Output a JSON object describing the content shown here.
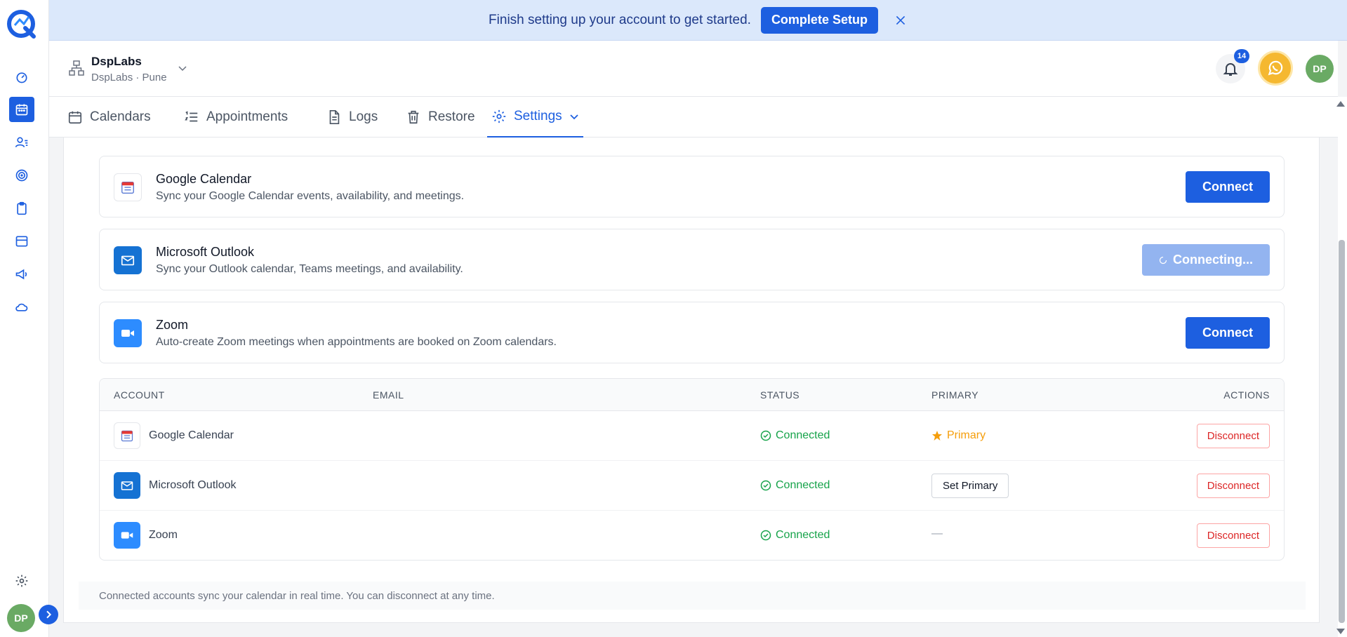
{
  "banner": {
    "message": "Finish setting up your account to get started.",
    "cta_label": "Complete Setup"
  },
  "header": {
    "org_name": "DspLabs",
    "org_sub": "DspLabs · Pune",
    "notification_count": "14",
    "avatar_initials": "DP"
  },
  "sidebar": {
    "avatar_initials": "DP",
    "items": [
      "dashboard-icon",
      "calendar-icon",
      "contacts-icon",
      "target-icon",
      "clipboard-icon",
      "inbox-icon",
      "megaphone-icon",
      "cloud-icon",
      "gear-icon"
    ]
  },
  "tabs": [
    {
      "label": "Calendars",
      "icon": "calendar-icon"
    },
    {
      "label": "Appointments",
      "icon": "list-icon"
    },
    {
      "label": "Logs",
      "icon": "document-icon"
    },
    {
      "label": "Restore",
      "icon": "trash-icon"
    },
    {
      "label": "Settings",
      "icon": "gear-icon",
      "active": true
    }
  ],
  "integrations": [
    {
      "title": "Google Calendar",
      "desc": "Sync your Google Calendar events, availability, and meetings.",
      "button": "Connect"
    },
    {
      "title": "Microsoft Outlook",
      "desc": "Sync your Outlook calendar, Teams meetings, and availability.",
      "button": "Connecting..."
    },
    {
      "title": "Zoom",
      "desc": "Auto-create Zoom meetings when appointments are booked on Zoom calendars.",
      "button": "Connect"
    }
  ],
  "table": {
    "headers": {
      "account": "ACCOUNT",
      "email": "EMAIL",
      "status": "STATUS",
      "primary": "PRIMARY",
      "actions": "ACTIONS"
    },
    "rows": [
      {
        "account": "Google Calendar",
        "status": "Connected",
        "primary": "Primary",
        "action": "Disconnect"
      },
      {
        "account": "Microsoft Outlook",
        "status": "Connected",
        "primary": "Set Primary",
        "action": "Disconnect"
      },
      {
        "account": "Zoom",
        "status": "Connected",
        "primary": "—",
        "action": "Disconnect"
      }
    ]
  },
  "footnote": "Connected accounts sync your calendar in real time. You can disconnect at any time.",
  "colors": {
    "accent": "#1d5fe0",
    "success": "#16a34a",
    "danger": "#dc2626",
    "primary_star": "#f59e0b"
  }
}
